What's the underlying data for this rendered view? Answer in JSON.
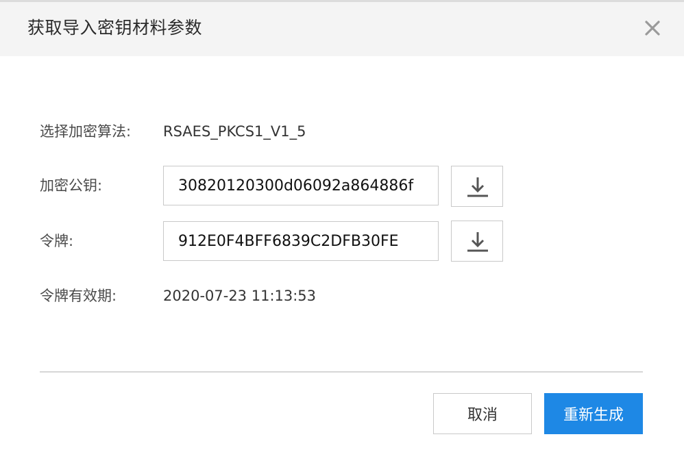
{
  "dialog": {
    "title": "获取导入密钥材料参数",
    "close_icon": "close-icon"
  },
  "form": {
    "algorithm": {
      "label": "选择加密算法:",
      "value": "RSAES_PKCS1_V1_5"
    },
    "public_key": {
      "label": "加密公钥:",
      "value": "30820120300d06092a864886f",
      "download_icon": "download-icon"
    },
    "token": {
      "label": "令牌:",
      "value": "912E0F4BFF6839C2DFB30FE",
      "download_icon": "download-icon"
    },
    "token_expiry": {
      "label": "令牌有效期:",
      "value": "2020-07-23 11:13:53"
    }
  },
  "footer": {
    "cancel_label": "取消",
    "regenerate_label": "重新生成"
  },
  "colors": {
    "primary": "#1e88e5",
    "header_bg": "#f4f4f4",
    "border": "#c8c8c8"
  }
}
